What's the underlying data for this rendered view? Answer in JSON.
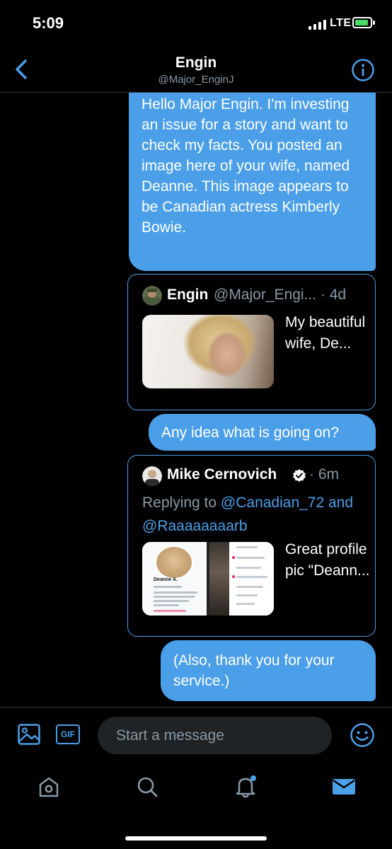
{
  "status_bar": {
    "time": "5:09",
    "network": "LTE"
  },
  "header": {
    "name": "Engin",
    "handle": "@Major_EnginJ"
  },
  "messages": {
    "first": "Hello Major Engin. I'm investing an issue for a story and want to check my facts. You posted an image here of your wife, named Deanne. This image appears to be Canadian actress Kimberly Bowie.",
    "second": "Any idea what is going on?",
    "third": "(Also, thank you for your service.)"
  },
  "tweet_card_1": {
    "name": "Engin",
    "handle_time": "@Major_Engi... · 4d",
    "text": "My beautiful wife, De..."
  },
  "tweet_card_2": {
    "name": "Mike Cernovich",
    "time": "· 6m",
    "replying_prefix": "Replying to",
    "mention_1": "@Canadian_72",
    "and_word": "and",
    "mention_2": "@Raaaaaaaarb",
    "text": "Great profile pic \"Deann...",
    "thumb_name": "Deanne A."
  },
  "composer": {
    "gif_label": "GIF",
    "placeholder": "Start a message"
  },
  "tabs": [
    "home-icon",
    "search-icon",
    "notifications-icon",
    "messages-icon"
  ],
  "colors": {
    "accent": "#4b9fe8",
    "background": "#000000",
    "secondary_text": "#8899a6",
    "battery": "#4cd964"
  }
}
